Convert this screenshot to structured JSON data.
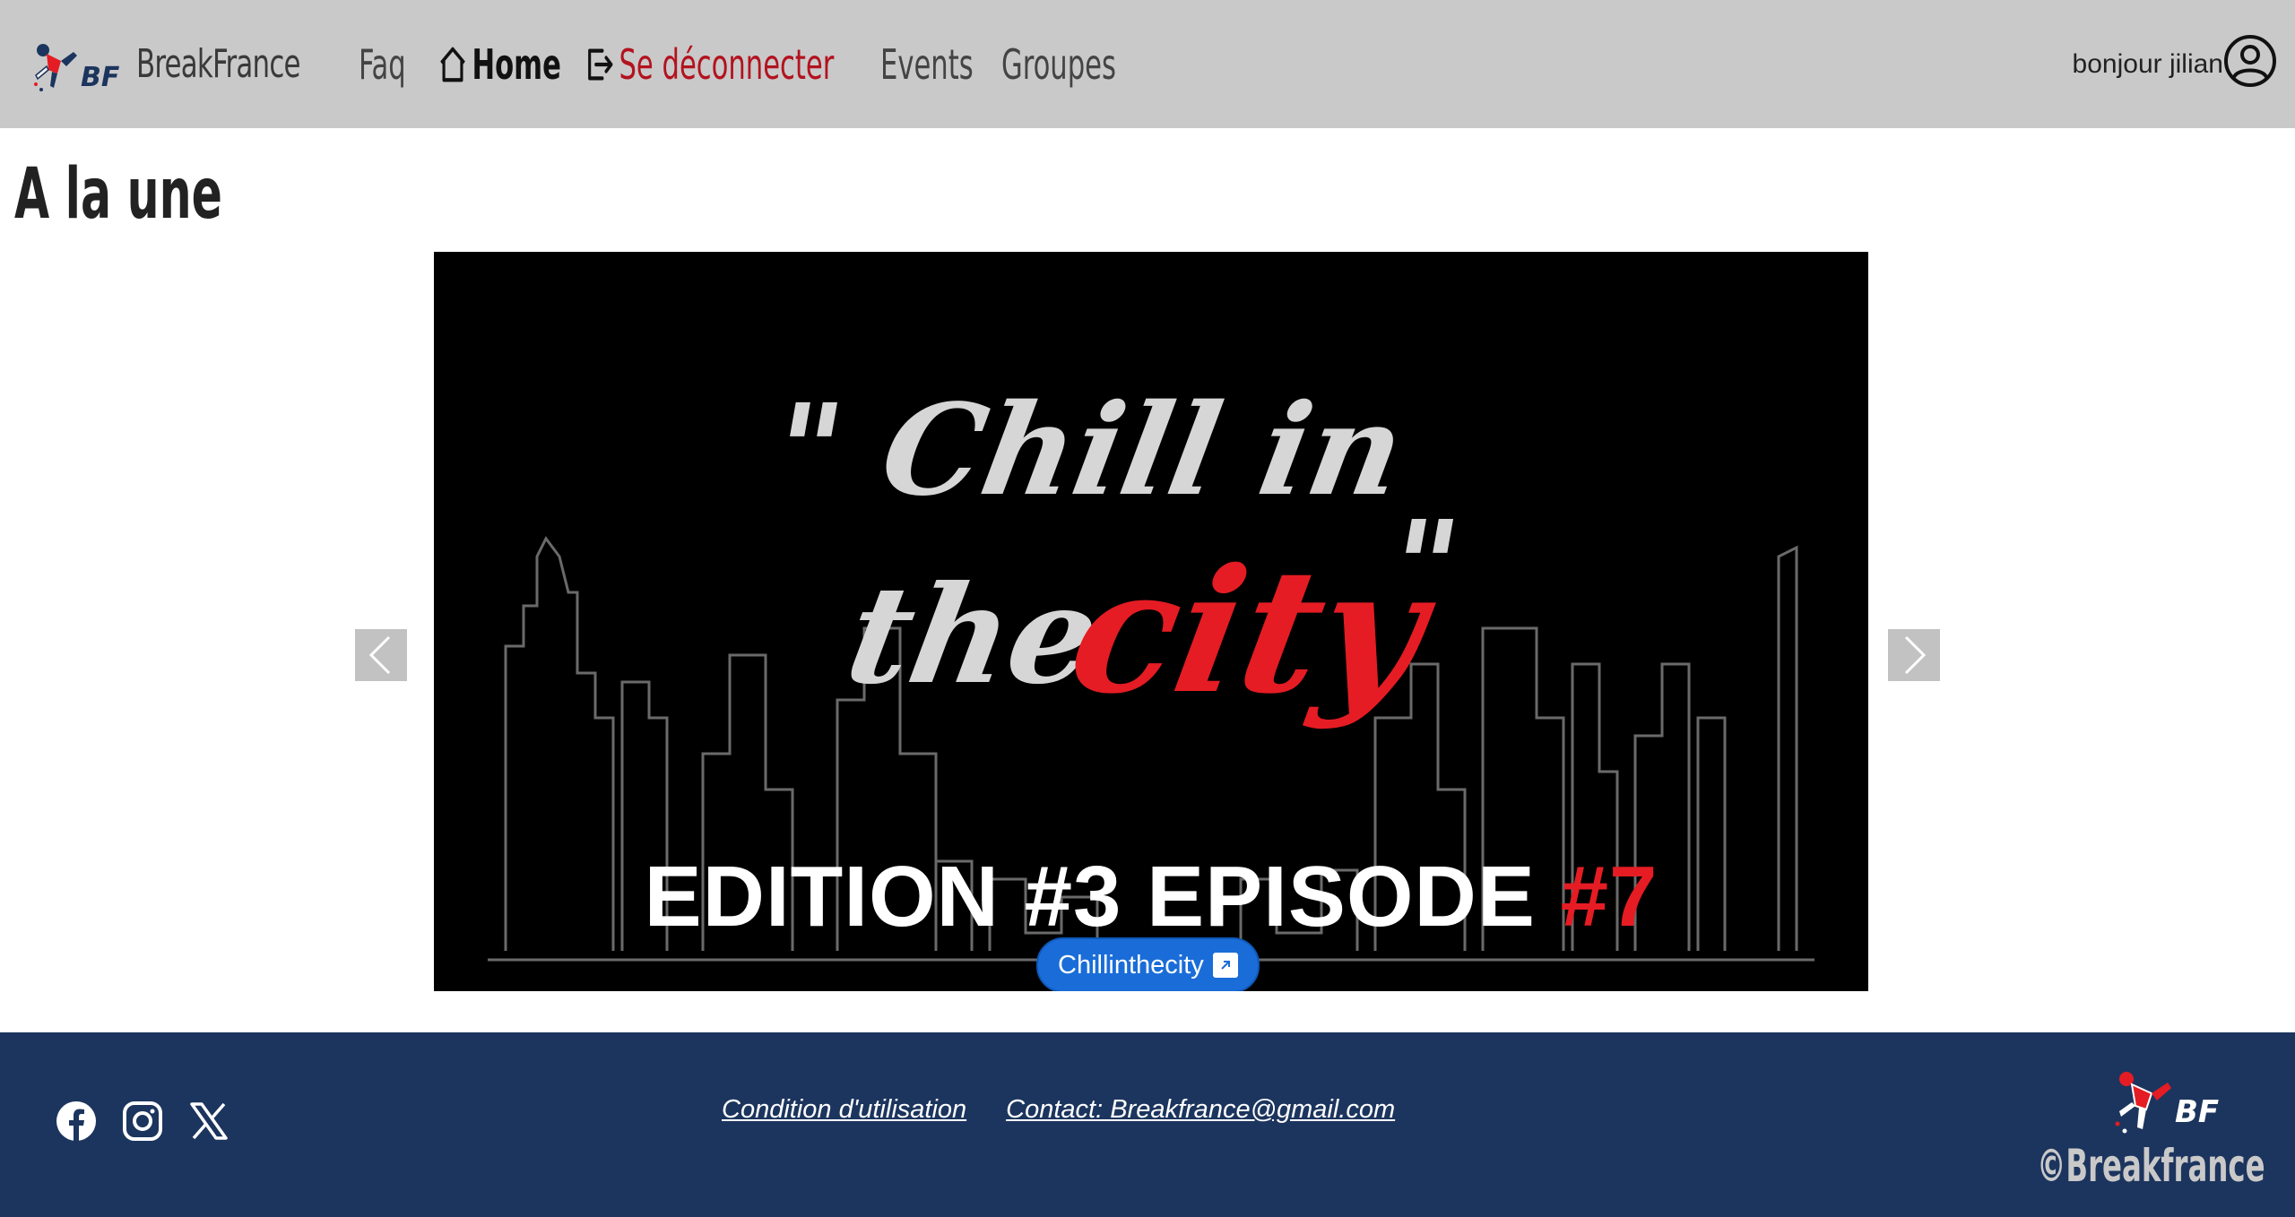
{
  "navbar": {
    "brand": "BreakFrance",
    "links": {
      "faq": "Faq",
      "home": "Home",
      "logout": "Se déconnecter",
      "events": "Events",
      "groupes": "Groupes"
    },
    "user_greeting": "bonjour jilian",
    "background": "#c9c9c9",
    "logout_color": "#b3121f"
  },
  "main": {
    "title": "A la une",
    "carousel": {
      "slide_title_line1": "\" Chill in",
      "slide_title_the": "the",
      "slide_title_city": "city",
      "slide_title_close": "\"",
      "slide_edition": "EDITION #3 EPISODE ",
      "slide_edition_number": "#7",
      "badge_label": "Chillinthecity",
      "controls": [
        "previous",
        "next"
      ]
    }
  },
  "footer": {
    "social_icons": [
      "facebook-icon",
      "instagram-icon",
      "x-icon"
    ],
    "links": {
      "terms": "Condition d'utilisation",
      "contact": "Contact: Breakfrance@gmail.com"
    },
    "copyright": "©Breakfrance",
    "background": "#1c355e"
  }
}
